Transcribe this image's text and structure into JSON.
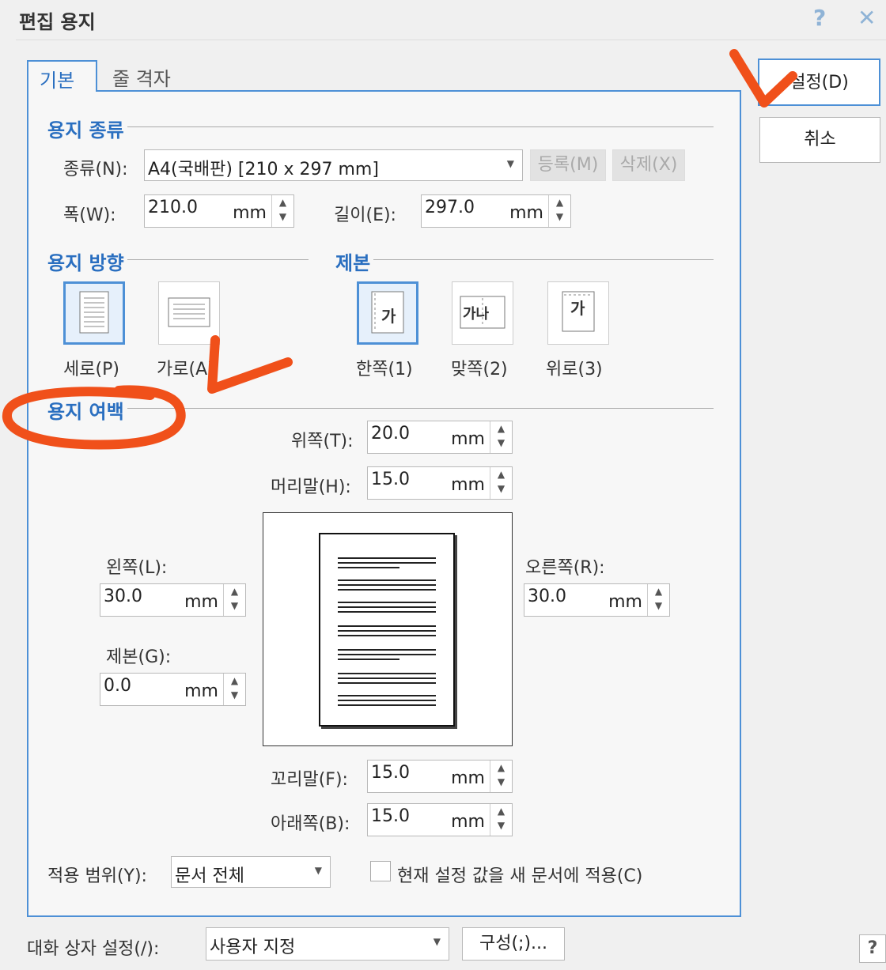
{
  "window": {
    "title": "편집 용지",
    "help_button": "?",
    "close_button": "✕"
  },
  "tabs": [
    {
      "label": "기본"
    },
    {
      "label": "줄 격자"
    }
  ],
  "buttons": {
    "ok": "설정(D)",
    "cancel": "취소",
    "register": "등록(M)",
    "delete": "삭제(X)",
    "configure": "구성(;)...",
    "help": "?"
  },
  "paper_type": {
    "section": "용지 종류",
    "type_label": "종류(N):",
    "type_value": "A4(국배판)  [210 x 297 mm]",
    "width_label": "폭(W):",
    "width_value": "210.0",
    "height_label": "길이(E):",
    "height_value": "297.0",
    "unit": "mm"
  },
  "orientation": {
    "section": "용지 방향",
    "portrait": "세로(P)",
    "landscape": "가로(A)"
  },
  "binding": {
    "section": "제본",
    "single": "한쪽(1)",
    "facing": "맞쪽(2)",
    "top": "위로(3)",
    "icon_single": "가",
    "icon_facing": "가나",
    "icon_top": "가"
  },
  "margins": {
    "section": "용지 여백",
    "top_label": "위쪽(T):",
    "top_value": "20.0",
    "header_label": "머리말(H):",
    "header_value": "15.0",
    "left_label": "왼쪽(L):",
    "left_value": "30.0",
    "right_label": "오른쪽(R):",
    "right_value": "30.0",
    "gutter_label": "제본(G):",
    "gutter_value": "0.0",
    "footer_label": "꼬리말(F):",
    "footer_value": "15.0",
    "bottom_label": "아래쪽(B):",
    "bottom_value": "15.0",
    "unit": "mm"
  },
  "apply": {
    "label": "적용 범위(Y):",
    "value": "문서 전체",
    "checkbox_label": "현재 설정 값을 새 문서에 적용(C)"
  },
  "dialog_settings": {
    "label": "대화 상자 설정(/):",
    "value": "사용자 지정"
  },
  "colors": {
    "accent": "#4d90d6",
    "annotation": "#f0501a"
  }
}
